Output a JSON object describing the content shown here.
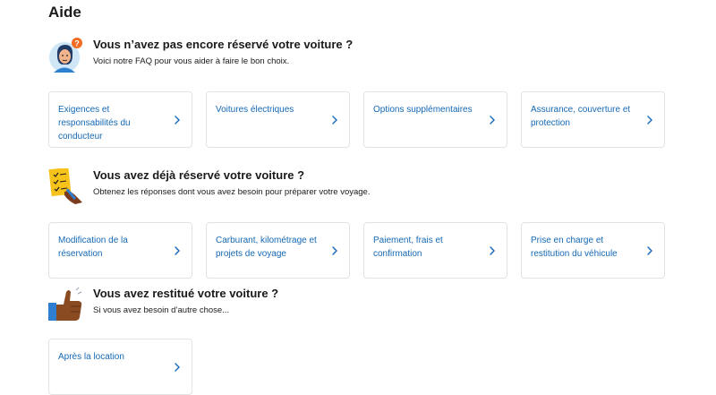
{
  "page": {
    "title": "Aide"
  },
  "sections": [
    {
      "title": "Vous n’avez pas encore réservé votre voiture ?",
      "subtitle": "Voici notre FAQ pour vous aider à faire le bon choix.",
      "icon": "confused-person-icon",
      "cards": [
        {
          "label": "Exigences et responsabilités du conducteur"
        },
        {
          "label": "Voitures électriques"
        },
        {
          "label": "Options supplémentaires"
        },
        {
          "label": "Assurance, couverture et protection"
        }
      ]
    },
    {
      "title": "Vous avez déjà réservé votre voiture ?",
      "subtitle": "Obtenez les réponses dont vous avez besoin pour préparer votre voyage.",
      "icon": "checklist-icon",
      "cards": [
        {
          "label": "Modification de la réservation"
        },
        {
          "label": "Carburant, kilométrage et projets de voyage"
        },
        {
          "label": "Paiement, frais et confirmation"
        },
        {
          "label": "Prise en charge et restitution du véhicule"
        }
      ]
    },
    {
      "title": "Vous avez restitué votre voiture ?",
      "subtitle": "Si vous avez besoin d’autre chose...",
      "icon": "thumbs-up-icon",
      "cards": [
        {
          "label": "Après la location"
        }
      ]
    }
  ],
  "colors": {
    "link": "#1468b4",
    "card_border": "#e3e3e3"
  }
}
